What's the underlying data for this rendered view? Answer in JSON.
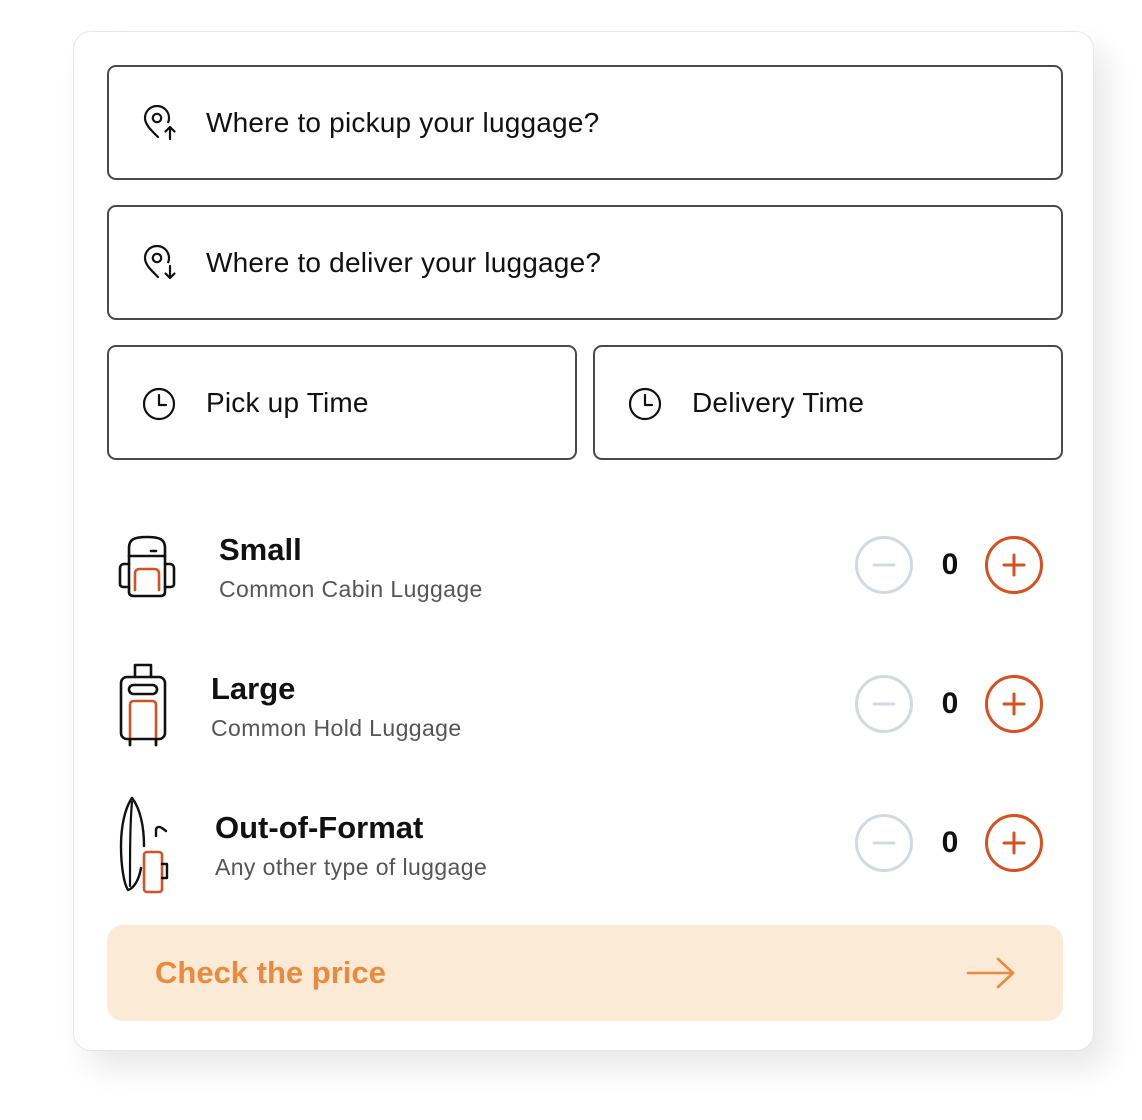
{
  "form": {
    "pickup_placeholder": "Where to pickup your luggage?",
    "delivery_placeholder": "Where to deliver your luggage?",
    "pickup_time_placeholder": "Pick up Time",
    "delivery_time_placeholder": "Delivery Time"
  },
  "luggage": [
    {
      "title": "Small",
      "subtitle": "Common Cabin Luggage",
      "count": "0",
      "icon": "backpack-icon"
    },
    {
      "title": "Large",
      "subtitle": "Common Hold Luggage",
      "count": "0",
      "icon": "suitcase-icon"
    },
    {
      "title": "Out-of-Format",
      "subtitle": "Any other type of luggage",
      "count": "0",
      "icon": "surfboard-icon"
    }
  ],
  "cta": {
    "label": "Check the price"
  },
  "colors": {
    "accent": "#d8501f",
    "cta_text": "#ea8a3c",
    "cta_background": "#faead6",
    "minus_border": "#d3d9e2",
    "field_border": "#4a4a4a"
  }
}
